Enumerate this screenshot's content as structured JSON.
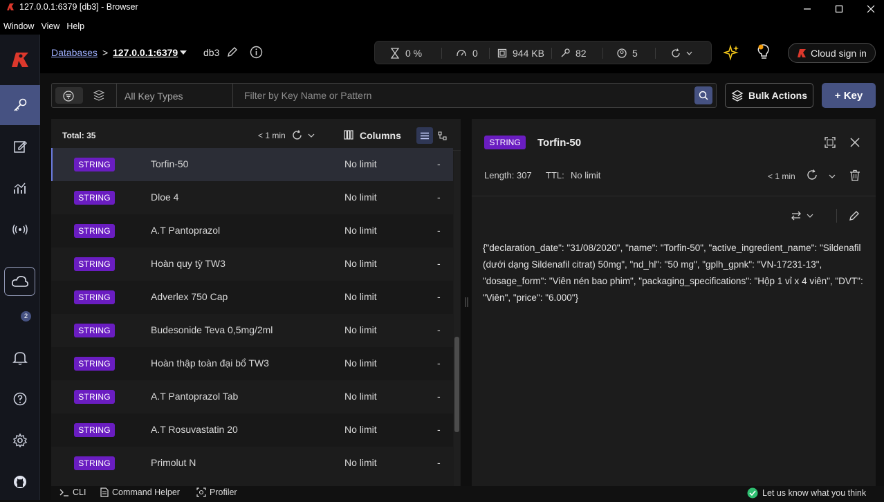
{
  "window": {
    "title": "127.0.0.1:6379 [db3] - Browser",
    "menu": [
      "Window",
      "View",
      "Help"
    ]
  },
  "header": {
    "databases_link": "Databases",
    "separator": ">",
    "host": "127.0.0.1:6379",
    "db": "db3",
    "stats": {
      "cpu": "0 %",
      "ops": "0",
      "memory": "944 KB",
      "keys": "82",
      "clients": "5"
    },
    "cloud_signin": "Cloud sign in"
  },
  "filter": {
    "key_type": "All Key Types",
    "placeholder": "Filter by Key Name or Pattern",
    "bulk_actions": "Bulk Actions",
    "add_key": "+ Key"
  },
  "list": {
    "total": "Total: 35",
    "refreshed": "< 1 min",
    "columns_label": "Columns",
    "rows": [
      {
        "type": "STRING",
        "name": "Torfin-50",
        "ttl": "No limit",
        "size": "-"
      },
      {
        "type": "STRING",
        "name": "Dloe 4",
        "ttl": "No limit",
        "size": "-"
      },
      {
        "type": "STRING",
        "name": "A.T Pantoprazol",
        "ttl": "No limit",
        "size": "-"
      },
      {
        "type": "STRING",
        "name": "Hoàn quy tỳ TW3",
        "ttl": "No limit",
        "size": "-"
      },
      {
        "type": "STRING",
        "name": "Adverlex 750 Cap",
        "ttl": "No limit",
        "size": "-"
      },
      {
        "type": "STRING",
        "name": "Budesonide Teva 0,5mg/2ml",
        "ttl": "No limit",
        "size": "-"
      },
      {
        "type": "STRING",
        "name": "Hoàn thập toàn đại bổ TW3",
        "ttl": "No limit",
        "size": "-"
      },
      {
        "type": "STRING",
        "name": "A.T Pantoprazol Tab",
        "ttl": "No limit",
        "size": "-"
      },
      {
        "type": "STRING",
        "name": "A.T Rosuvastatin 20",
        "ttl": "No limit",
        "size": "-"
      },
      {
        "type": "STRING",
        "name": "Primolut N",
        "ttl": "No limit",
        "size": "-"
      }
    ]
  },
  "detail": {
    "type": "STRING",
    "key": "Torfin-50",
    "length": "Length: 307",
    "ttl_label": "TTL:",
    "ttl": "No limit",
    "refreshed": "< 1 min",
    "value": "{\"declaration_date\": \"31/08/2020\", \"name\": \"Torfin-50\", \"active_ingredient_name\": \"Sildenafil (dưới dạng Sildenafil citrat) 50mg\", \"nd_hl\": \"50 mg\", \"gplh_gpnk\": \"VN-17231-13\", \"dosage_form\": \"Viên nén bao phim\", \"packaging_specifications\": \"Hộp 1 vỉ x 4 viên\", \"DVT\": \"Viên\", \"price\": \"6.000\"}"
  },
  "sidebar": {
    "notification_count": "2"
  },
  "bottom": {
    "cli": "CLI",
    "command_helper": "Command Helper",
    "profiler": "Profiler",
    "feedback": "Let us know what you think"
  },
  "colors": {
    "accent": "#465282",
    "string_badge": "#6a1dc1",
    "brand_red": "#dc382c"
  }
}
